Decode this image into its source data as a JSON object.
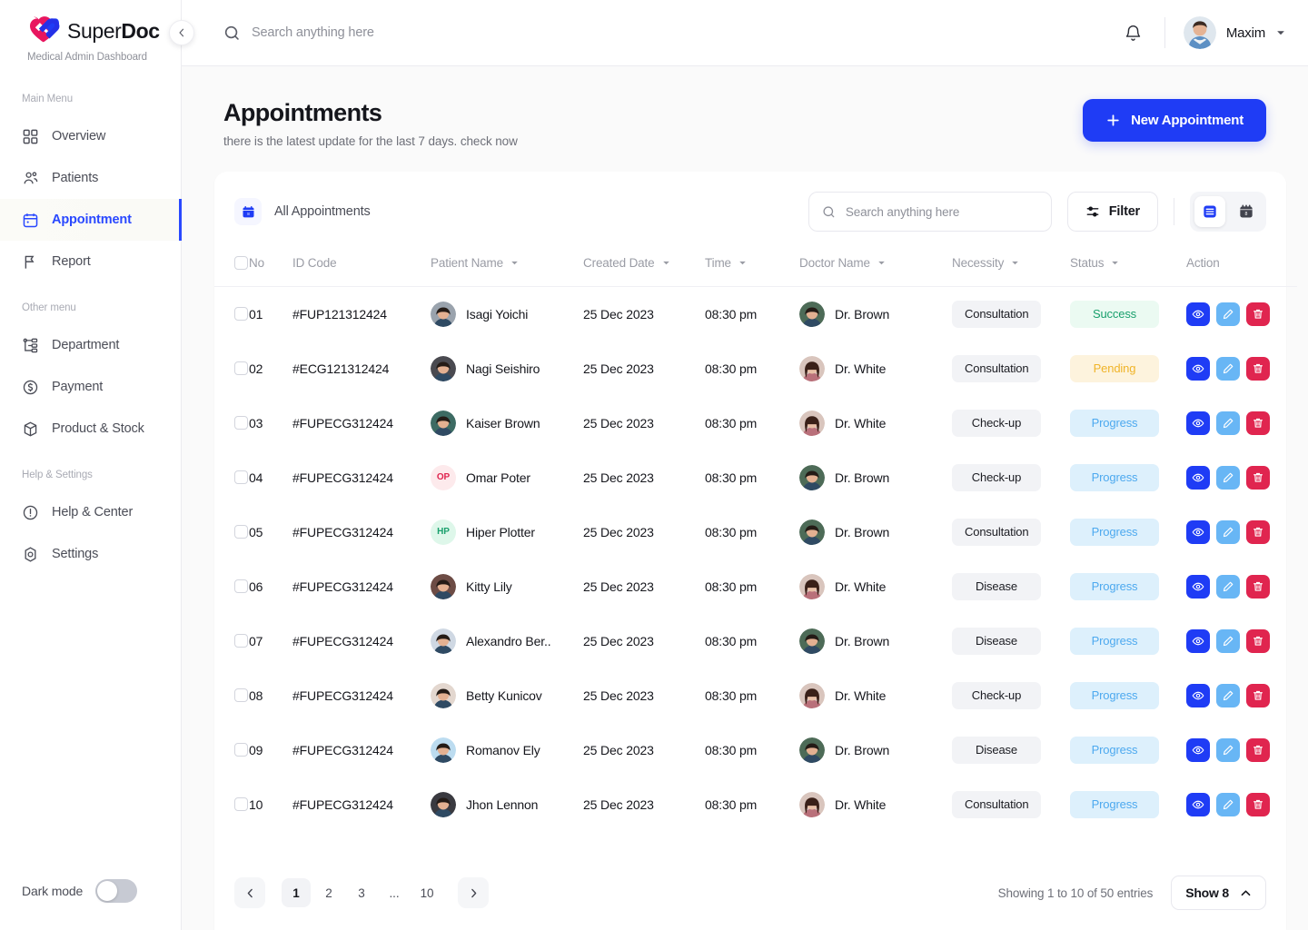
{
  "brand": {
    "name_light": "Super",
    "name_bold": "Doc",
    "subtitle": "Medical Admin Dashboard"
  },
  "sidebar": {
    "sections": [
      {
        "label": "Main Menu",
        "items": [
          {
            "label": "Overview",
            "icon": "grid-icon",
            "active": false
          },
          {
            "label": "Patients",
            "icon": "users-icon",
            "active": false
          },
          {
            "label": "Appointment",
            "icon": "calendar-icon",
            "active": true
          },
          {
            "label": "Report",
            "icon": "flag-icon",
            "active": false
          }
        ]
      },
      {
        "label": "Other menu",
        "items": [
          {
            "label": "Department",
            "icon": "hierarchy-icon",
            "active": false
          },
          {
            "label": "Payment",
            "icon": "dollar-circle-icon",
            "active": false
          },
          {
            "label": "Product & Stock",
            "icon": "box-icon",
            "active": false
          }
        ]
      },
      {
        "label": "Help & Settings",
        "items": [
          {
            "label": "Help & Center",
            "icon": "info-circle-icon",
            "active": false
          },
          {
            "label": "Settings",
            "icon": "gear-icon",
            "active": false
          }
        ]
      }
    ],
    "dark_mode_label": "Dark mode",
    "dark_mode_on": false
  },
  "topbar": {
    "search_placeholder": "Search anything here",
    "search_value": "",
    "user_name": "Maxim"
  },
  "page": {
    "title": "Appointments",
    "subtitle": "there is the latest update for the last 7 days. check now",
    "new_button": "New Appointment"
  },
  "toolbar": {
    "chip_label": "All Appointments",
    "search_placeholder": "Search anything here",
    "search_value": "",
    "filter_label": "Filter",
    "view_list_active": true
  },
  "table": {
    "columns": [
      {
        "label": "No",
        "sortable": false
      },
      {
        "label": "ID Code",
        "sortable": false
      },
      {
        "label": "Patient Name",
        "sortable": true
      },
      {
        "label": "Created Date",
        "sortable": true
      },
      {
        "label": "Time",
        "sortable": true
      },
      {
        "label": "Doctor Name",
        "sortable": true
      },
      {
        "label": "Necessity",
        "sortable": true
      },
      {
        "label": "Status",
        "sortable": true
      },
      {
        "label": "Action",
        "sortable": false
      }
    ],
    "rows": [
      {
        "no": "01",
        "id_code": "#FUP121312424",
        "patient": "Isagi Yoichi",
        "patient_avatar": "photo",
        "avatar_color": "#9aa3ad",
        "date": "25 Dec 2023",
        "time": "08:30 pm",
        "doctor": "Dr. Brown",
        "doctor_avatar": "photo-m",
        "necessity": "Consultation",
        "status": "Success",
        "status_key": "success"
      },
      {
        "no": "02",
        "id_code": "#ECG121312424",
        "patient": "Nagi Seishiro",
        "patient_avatar": "photo",
        "avatar_color": "#4a4a50",
        "date": "25 Dec 2023",
        "time": "08:30 pm",
        "doctor": "Dr. White",
        "doctor_avatar": "photo-f",
        "necessity": "Consultation",
        "status": "Pending",
        "status_key": "pending"
      },
      {
        "no": "03",
        "id_code": "#FUPECG312424",
        "patient": "Kaiser Brown",
        "patient_avatar": "photo",
        "avatar_color": "#3d6b63",
        "date": "25 Dec 2023",
        "time": "08:30 pm",
        "doctor": "Dr. White",
        "doctor_avatar": "photo-f",
        "necessity": "Check-up",
        "status": "Progress",
        "status_key": "progress"
      },
      {
        "no": "04",
        "id_code": "#FUPECG312424",
        "patient": "Omar Poter",
        "patient_avatar": "initials",
        "initials": "OP",
        "avatar_color": "#fdeaec",
        "initials_color": "#e0254f",
        "date": "25 Dec 2023",
        "time": "08:30 pm",
        "doctor": "Dr. Brown",
        "doctor_avatar": "photo-m",
        "necessity": "Check-up",
        "status": "Progress",
        "status_key": "progress"
      },
      {
        "no": "05",
        "id_code": "#FUPECG312424",
        "patient": "Hiper Plotter",
        "patient_avatar": "initials",
        "initials": "HP",
        "avatar_color": "#def7ea",
        "initials_color": "#1aa06d",
        "date": "25 Dec 2023",
        "time": "08:30 pm",
        "doctor": "Dr. Brown",
        "doctor_avatar": "photo-m",
        "necessity": "Consultation",
        "status": "Progress",
        "status_key": "progress"
      },
      {
        "no": "06",
        "id_code": "#FUPECG312424",
        "patient": "Kitty Lily",
        "patient_avatar": "photo",
        "avatar_color": "#6d4c45",
        "date": "25 Dec 2023",
        "time": "08:30 pm",
        "doctor": "Dr. White",
        "doctor_avatar": "photo-f",
        "necessity": "Disease",
        "status": "Progress",
        "status_key": "progress"
      },
      {
        "no": "07",
        "id_code": "#FUPECG312424",
        "patient": "Alexandro Ber..",
        "patient_avatar": "photo",
        "avatar_color": "#cfd8e3",
        "date": "25 Dec 2023",
        "time": "08:30 pm",
        "doctor": "Dr. Brown",
        "doctor_avatar": "photo-m",
        "necessity": "Disease",
        "status": "Progress",
        "status_key": "progress"
      },
      {
        "no": "08",
        "id_code": "#FUPECG312424",
        "patient": "Betty Kunicov",
        "patient_avatar": "photo",
        "avatar_color": "#e3d7cf",
        "date": "25 Dec 2023",
        "time": "08:30 pm",
        "doctor": "Dr. White",
        "doctor_avatar": "photo-f",
        "necessity": "Check-up",
        "status": "Progress",
        "status_key": "progress"
      },
      {
        "no": "09",
        "id_code": "#FUPECG312424",
        "patient": "Romanov Ely",
        "patient_avatar": "photo",
        "avatar_color": "#bcdcf0",
        "date": "25 Dec 2023",
        "time": "08:30 pm",
        "doctor": "Dr. Brown",
        "doctor_avatar": "photo-m",
        "necessity": "Disease",
        "status": "Progress",
        "status_key": "progress"
      },
      {
        "no": "10",
        "id_code": "#FUPECG312424",
        "patient": "Jhon Lennon",
        "patient_avatar": "photo",
        "avatar_color": "#3a3a40",
        "date": "25 Dec 2023",
        "time": "08:30 pm",
        "doctor": "Dr. White",
        "doctor_avatar": "photo-f",
        "necessity": "Consultation",
        "status": "Progress",
        "status_key": "progress"
      }
    ],
    "action_icons": [
      "eye-icon",
      "pencil-icon",
      "trash-icon"
    ]
  },
  "footer": {
    "pages": [
      "1",
      "2",
      "3",
      "...",
      "10"
    ],
    "current_page": "1",
    "entries_text": "Showing 1 to 10 of 50 entries",
    "show_label": "Show 8"
  },
  "colors": {
    "accent": "#1f3cf5",
    "success": "#1aa06d",
    "pending": "#f0b429",
    "progress": "#4da9ef",
    "danger": "#e0254f",
    "edit": "#68b6f5"
  }
}
